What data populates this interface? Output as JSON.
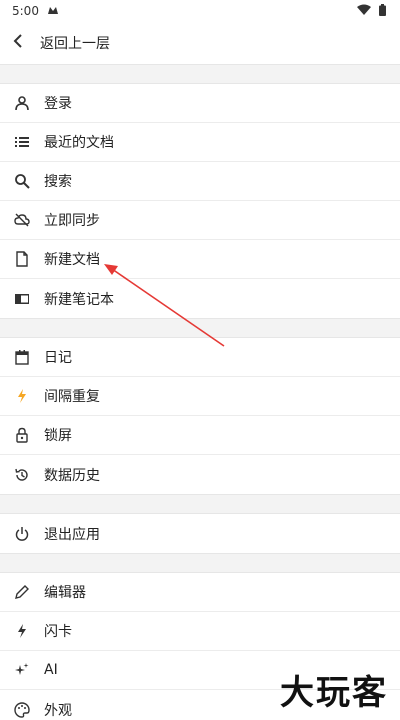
{
  "status_bar": {
    "time": "5:00"
  },
  "header": {
    "back_label": "返回上一层"
  },
  "sections": [
    {
      "items": [
        {
          "label": "登录",
          "icon": "user-icon"
        },
        {
          "label": "最近的文档",
          "icon": "list-icon"
        },
        {
          "label": "搜索",
          "icon": "search-icon"
        },
        {
          "label": "立即同步",
          "icon": "cloud-off-icon"
        },
        {
          "label": "新建文档",
          "icon": "document-icon"
        },
        {
          "label": "新建笔记本",
          "icon": "notebook-icon"
        }
      ]
    },
    {
      "items": [
        {
          "label": "日记",
          "icon": "calendar-icon"
        },
        {
          "label": "间隔重复",
          "icon": "bolt-icon"
        },
        {
          "label": "锁屏",
          "icon": "lock-icon"
        },
        {
          "label": "数据历史",
          "icon": "history-icon"
        }
      ]
    },
    {
      "items": [
        {
          "label": "退出应用",
          "icon": "power-icon"
        }
      ]
    },
    {
      "items": [
        {
          "label": "编辑器",
          "icon": "pencil-icon"
        },
        {
          "label": "闪卡",
          "icon": "flash-icon"
        },
        {
          "label": "AI",
          "icon": "sparkle-icon"
        },
        {
          "label": "外观",
          "icon": "palette-icon"
        }
      ]
    }
  ],
  "watermark": {
    "text": "大玩客"
  },
  "colors": {
    "accent_arrow": "#e53935",
    "bolt": "#f5a623"
  }
}
